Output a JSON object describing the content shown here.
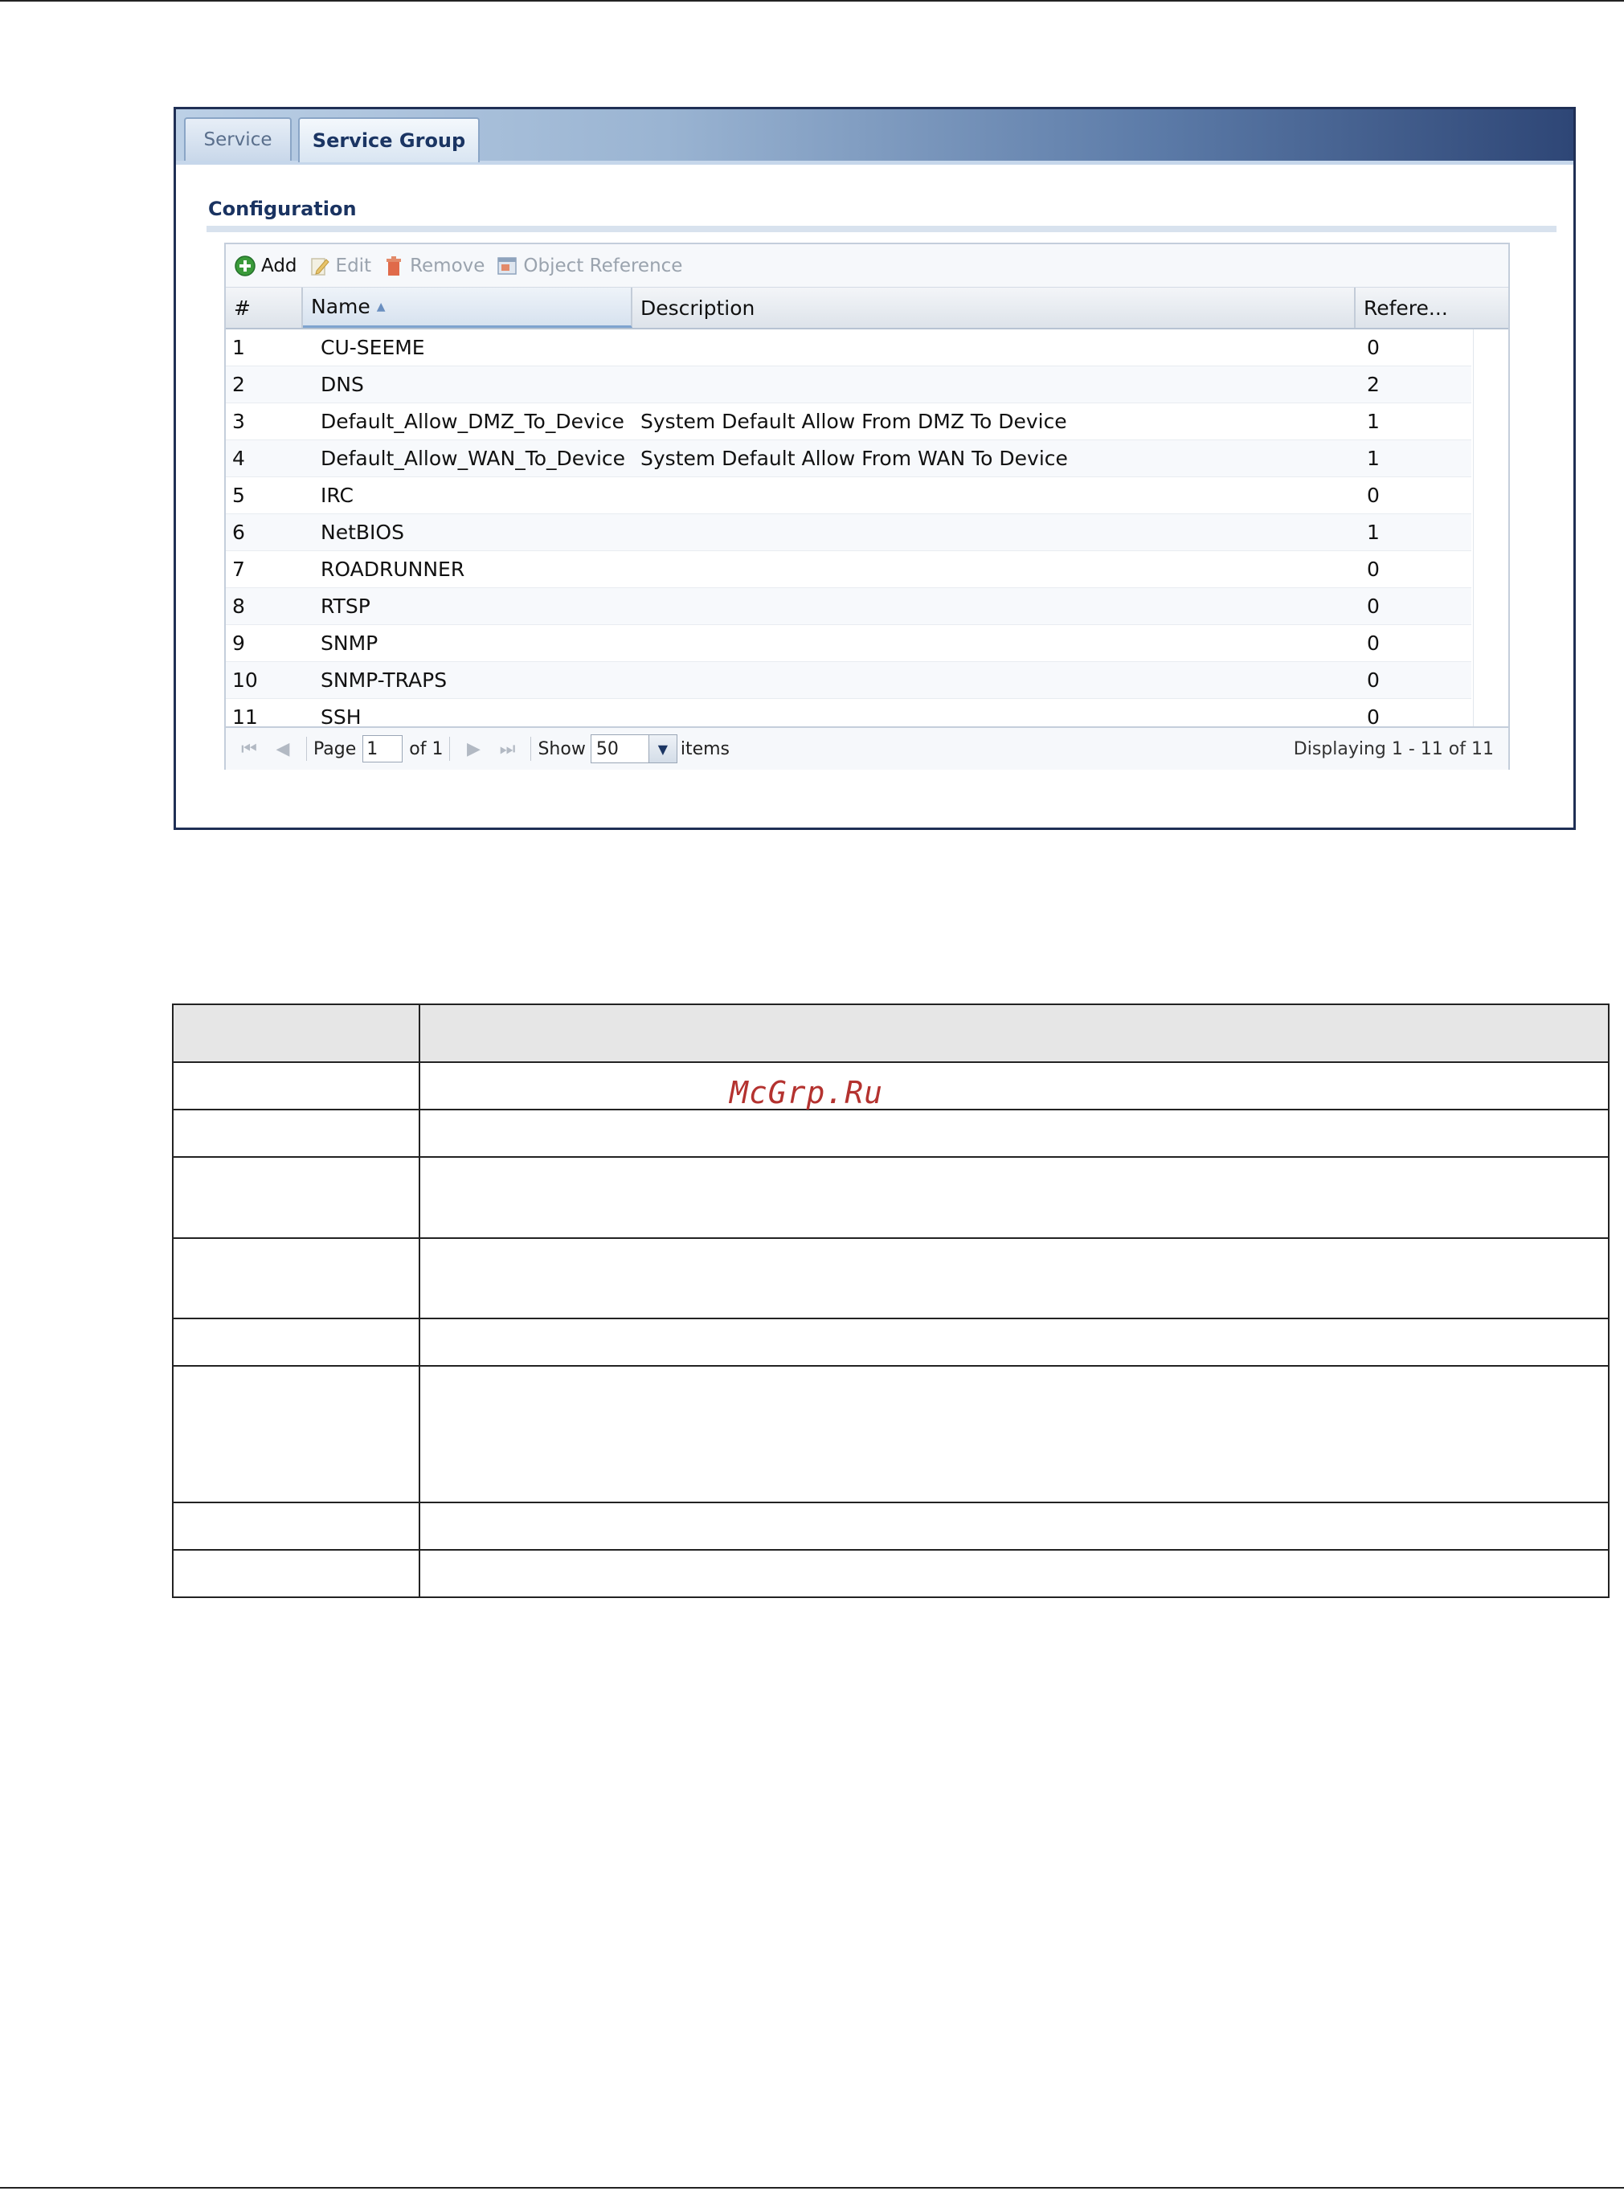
{
  "tabs": [
    {
      "label": "Service",
      "active": false
    },
    {
      "label": "Service Group",
      "active": true
    }
  ],
  "section": {
    "title": "Configuration"
  },
  "toolbar": {
    "add_label": "Add",
    "edit_label": "Edit",
    "remove_label": "Remove",
    "object_reference_label": "Object Reference"
  },
  "columns": {
    "index": "#",
    "name": "Name",
    "description": "Description",
    "reference": "Refere..."
  },
  "rows": [
    {
      "index": "1",
      "name": "CU-SEEME",
      "description": "",
      "reference": "0"
    },
    {
      "index": "2",
      "name": "DNS",
      "description": "",
      "reference": "2"
    },
    {
      "index": "3",
      "name": "Default_Allow_DMZ_To_Device",
      "description": "System Default Allow From DMZ To Device",
      "reference": "1"
    },
    {
      "index": "4",
      "name": "Default_Allow_WAN_To_Device",
      "description": "System Default Allow From WAN To Device",
      "reference": "1"
    },
    {
      "index": "5",
      "name": "IRC",
      "description": "",
      "reference": "0"
    },
    {
      "index": "6",
      "name": "NetBIOS",
      "description": "",
      "reference": "1"
    },
    {
      "index": "7",
      "name": "ROADRUNNER",
      "description": "",
      "reference": "0"
    },
    {
      "index": "8",
      "name": "RTSP",
      "description": "",
      "reference": "0"
    },
    {
      "index": "9",
      "name": "SNMP",
      "description": "",
      "reference": "0"
    },
    {
      "index": "10",
      "name": "SNMP-TRAPS",
      "description": "",
      "reference": "0"
    },
    {
      "index": "11",
      "name": "SSH",
      "description": "",
      "reference": "0"
    }
  ],
  "pager": {
    "page_label": "Page",
    "page_value": "1",
    "of_label": "of 1",
    "show_label": "Show",
    "show_value": "50",
    "items_label": "items",
    "display_text": "Displaying 1 - 11 of 11"
  },
  "watermark": "McGrp.Ru",
  "colors": {
    "frame_border": "#1f2f55",
    "active_tab_text": "#1b3563",
    "section_title": "#1a3361",
    "add_icon": "#3a9a3a",
    "remove_icon": "#e06a4a",
    "watermark": "#b4322f"
  }
}
